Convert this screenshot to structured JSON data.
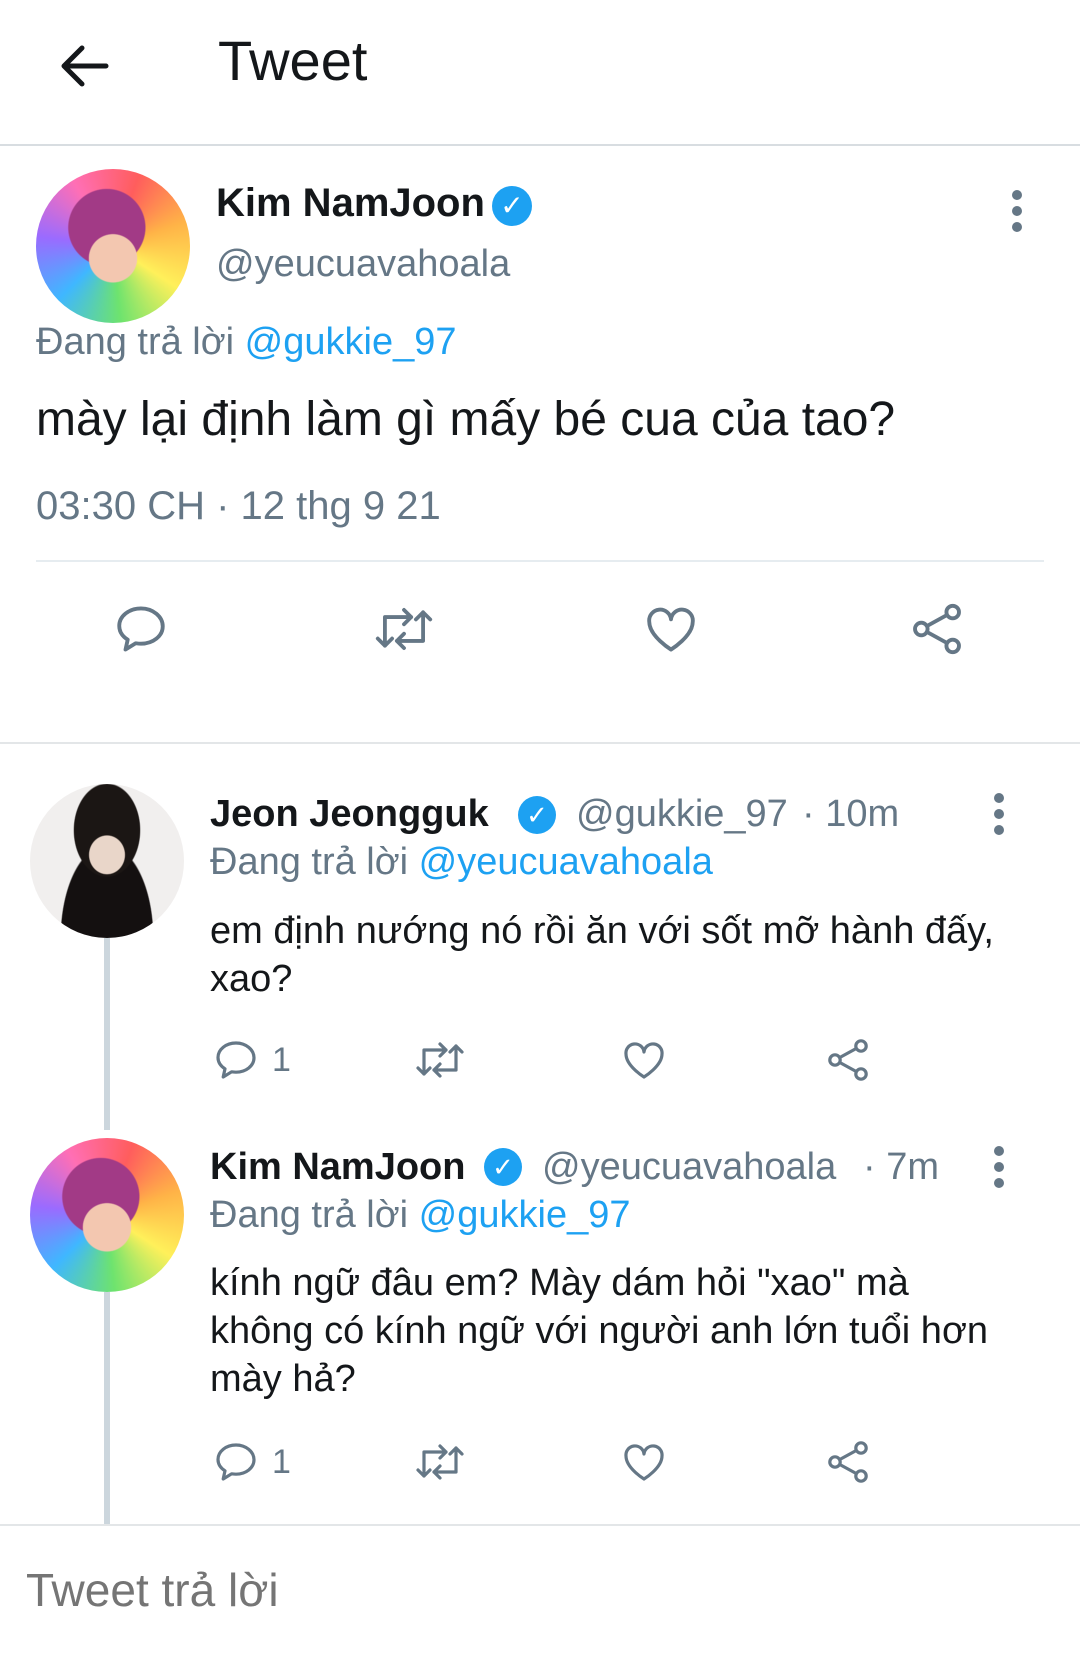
{
  "header": {
    "title": "Tweet"
  },
  "main_tweet": {
    "name": "Kim NamJoon",
    "handle": "@yeucuavahoala",
    "replying_prefix": "Đang trả lời ",
    "replying_to": "@gukkie_97",
    "text": "mày lại định làm gì mấy bé cua của tao?",
    "timestamp": "03:30 CH · 12 thg 9 21"
  },
  "replies": [
    {
      "name": "Jeon Jeongguk",
      "handle": "@gukkie_97",
      "time": "· 10m",
      "replying_prefix": "Đang trả lời ",
      "replying_to": "@yeucuavahoala",
      "text": "em định nướng nó rồi ăn với sốt mỡ hành đấy, xao?",
      "reply_count": "1"
    },
    {
      "name": "Kim NamJoon",
      "handle": "@yeucuavahoala",
      "time": "· 7m",
      "replying_prefix": "Đang trả lời ",
      "replying_to": "@gukkie_97",
      "text": "kính ngữ đâu em? Mày dám hỏi \"xao\" mà không có kính ngữ với người anh lớn tuổi hơn mày hả?",
      "reply_count": "1"
    }
  ],
  "compose": {
    "placeholder": "Tweet trả lời"
  },
  "colors": {
    "accent": "#1da1f2",
    "muted": "#657786",
    "text": "#14171a"
  },
  "icons": [
    "back-arrow-icon",
    "verified-badge-icon",
    "more-options-icon",
    "reply-icon",
    "retweet-icon",
    "like-icon",
    "share-icon"
  ]
}
